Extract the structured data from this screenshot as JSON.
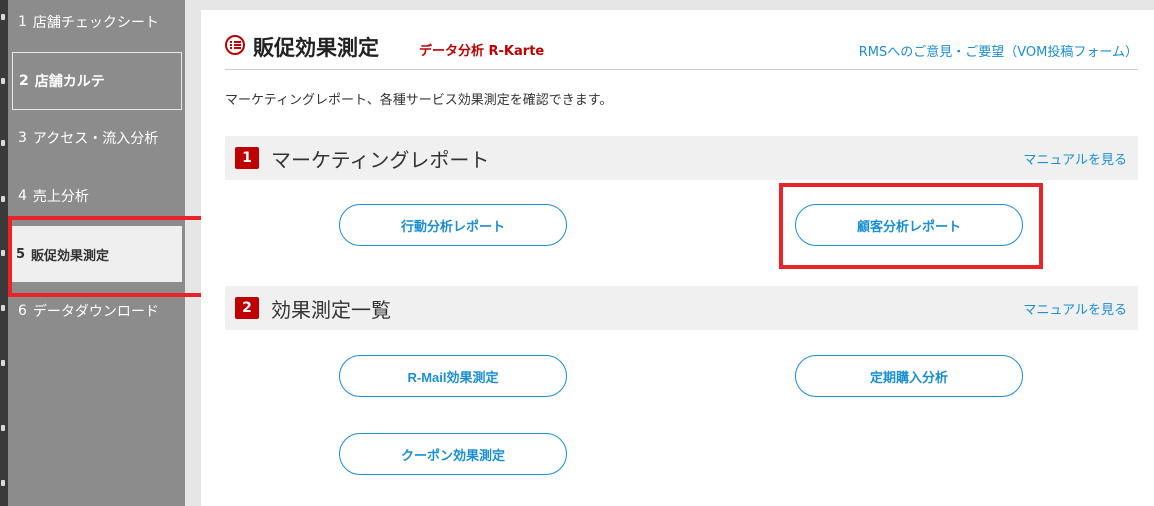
{
  "sidebar": {
    "items": [
      {
        "num": "1",
        "label": "店舗チェックシート"
      },
      {
        "num": "2",
        "label": "店舗カルテ"
      },
      {
        "num": "3",
        "label": "アクセス・流入分析"
      },
      {
        "num": "4",
        "label": "売上分析"
      },
      {
        "num": "5",
        "label": "販促効果測定"
      },
      {
        "num": "6",
        "label": "データダウンロード"
      }
    ]
  },
  "header": {
    "title": "販促効果測定",
    "subtitle": "データ分析 R-Karte",
    "feedback_link": "RMSへのご意見・ご要望（VOM投稿フォーム）"
  },
  "description": "マーケティングレポート、各種サービス効果測定を確認できます。",
  "sections": [
    {
      "num": "1",
      "title": "マーケティングレポート",
      "manual_link": "マニュアルを見る",
      "buttons": [
        "行動分析レポート",
        "顧客分析レポート"
      ]
    },
    {
      "num": "2",
      "title": "効果測定一覧",
      "manual_link": "マニュアルを見る",
      "buttons": [
        "R-Mail効果測定",
        "定期購入分析",
        "クーポン効果測定"
      ]
    }
  ],
  "colors": {
    "accent_red": "#bf0000",
    "link_blue": "#1a8fd1",
    "highlight_red": "#e8242a",
    "sidebar_gray": "#8c8c8c"
  }
}
